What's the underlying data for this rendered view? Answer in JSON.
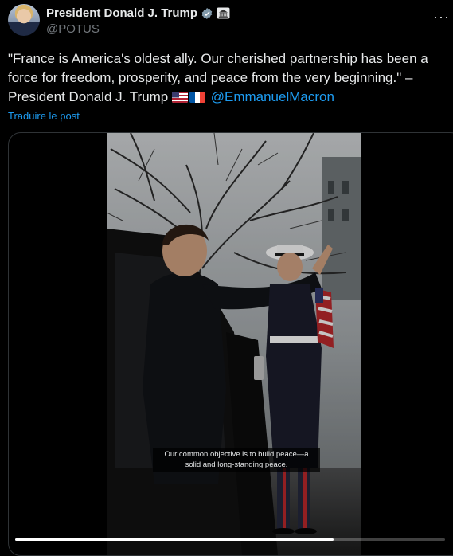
{
  "post": {
    "author_name": "President Donald J. Trump",
    "handle": "@POTUS",
    "verified_icon": "verified-badge-icon",
    "gov_icon": "white-house-icon",
    "more_label": "···",
    "text": "\"France is America's oldest ally. Our cherished partnership has been a force for freedom, prosperity, and peace from the very beginning.\" – President Donald J. Trump ",
    "flags": [
      "us-flag-icon",
      "france-flag-icon"
    ],
    "mention": "@EmmanuelMacron",
    "translate_label": "Traduire le post"
  },
  "video": {
    "caption": "Our common objective is to build peace—a solid and long-standing peace.",
    "progress": 0.74
  },
  "colors": {
    "background": "#000000",
    "text": "#e7e9ea",
    "secondary": "#71767b",
    "link": "#1d9bf0",
    "verified": "#829aab"
  }
}
